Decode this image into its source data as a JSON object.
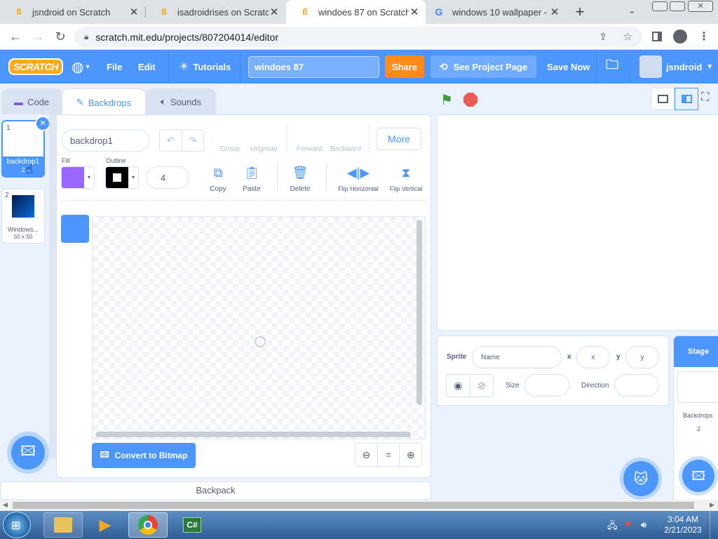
{
  "browser": {
    "tabs": [
      {
        "title": "jsndroid on Scratch",
        "icon": "scratch-cat-favicon",
        "active": false
      },
      {
        "title": "isadroidrises on Scratch",
        "icon": "scratch-cat-favicon",
        "active": false
      },
      {
        "title": "windoes 87 on Scratch",
        "icon": "scratch-cat-favicon",
        "active": true
      },
      {
        "title": "windows 10 wallpaper - G",
        "icon": "google-favicon",
        "active": false
      }
    ],
    "new_tab": "+",
    "url": "scratch.mit.edu/projects/807204014/editor"
  },
  "menu": {
    "logo": "SCRATCH",
    "file": "File",
    "edit": "Edit",
    "tutorials": "Tutorials",
    "project_title": "windoes 87",
    "share": "Share",
    "see_project_page": "See Project Page",
    "save_now": "Save Now",
    "username": "jsndroid"
  },
  "editor_tabs": {
    "code": "Code",
    "backdrops": "Backdrops",
    "sounds": "Sounds"
  },
  "costume_list": [
    {
      "index": "1",
      "name": "backdrop1",
      "size": "2",
      "selected": true
    },
    {
      "index": "2",
      "name": "Windows...",
      "size": "50 x 50",
      "selected": false
    }
  ],
  "paint": {
    "costume_name": "backdrop1",
    "group": "Group",
    "ungroup": "Ungroup",
    "forward": "Forward",
    "backward": "Backward",
    "more": "More",
    "fill_label": "Fill",
    "outline_label": "Outline",
    "outline_width": "4",
    "copy": "Copy",
    "paste": "Paste",
    "delete": "Delete",
    "flip_horizontal": "Flip Horizontal",
    "flip_vertical": "Flip Vertical",
    "convert": "Convert to Bitmap",
    "zoom_reset": "="
  },
  "backpack": "Backpack",
  "sprite_info": {
    "sprite_label": "Sprite",
    "name_placeholder": "Name",
    "x_label": "x",
    "x_placeholder": "x",
    "y_label": "y",
    "y_placeholder": "y",
    "size_label": "Size",
    "direction_label": "Direction"
  },
  "stage_panel": {
    "title": "Stage",
    "backdrops_label": "Backdrops",
    "backdrops_count": "2"
  },
  "taskbar": {
    "time": "3:04 AM",
    "date": "2/21/2023"
  },
  "colors": {
    "scratch_blue": "#4c97ff",
    "share_orange": "#ff8c1a",
    "fill_color": "#9966ff",
    "outline_color": "#000000"
  }
}
